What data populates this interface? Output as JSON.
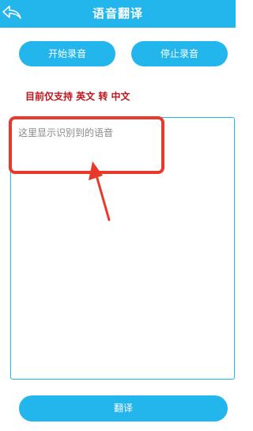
{
  "colors": {
    "accent": "#22b6ec",
    "notice": "#c0141c",
    "annotation": "#e8392a"
  },
  "header": {
    "back_icon": "back-arrow-icon",
    "title": "语音翻译"
  },
  "buttons": {
    "start_label": "开始录音",
    "stop_label": "停止录音",
    "translate_label": "翻译"
  },
  "notice": {
    "text": "目前仅支持 英文 转 中文"
  },
  "recognition": {
    "value": "",
    "placeholder": "这里显示识别到的语音"
  }
}
